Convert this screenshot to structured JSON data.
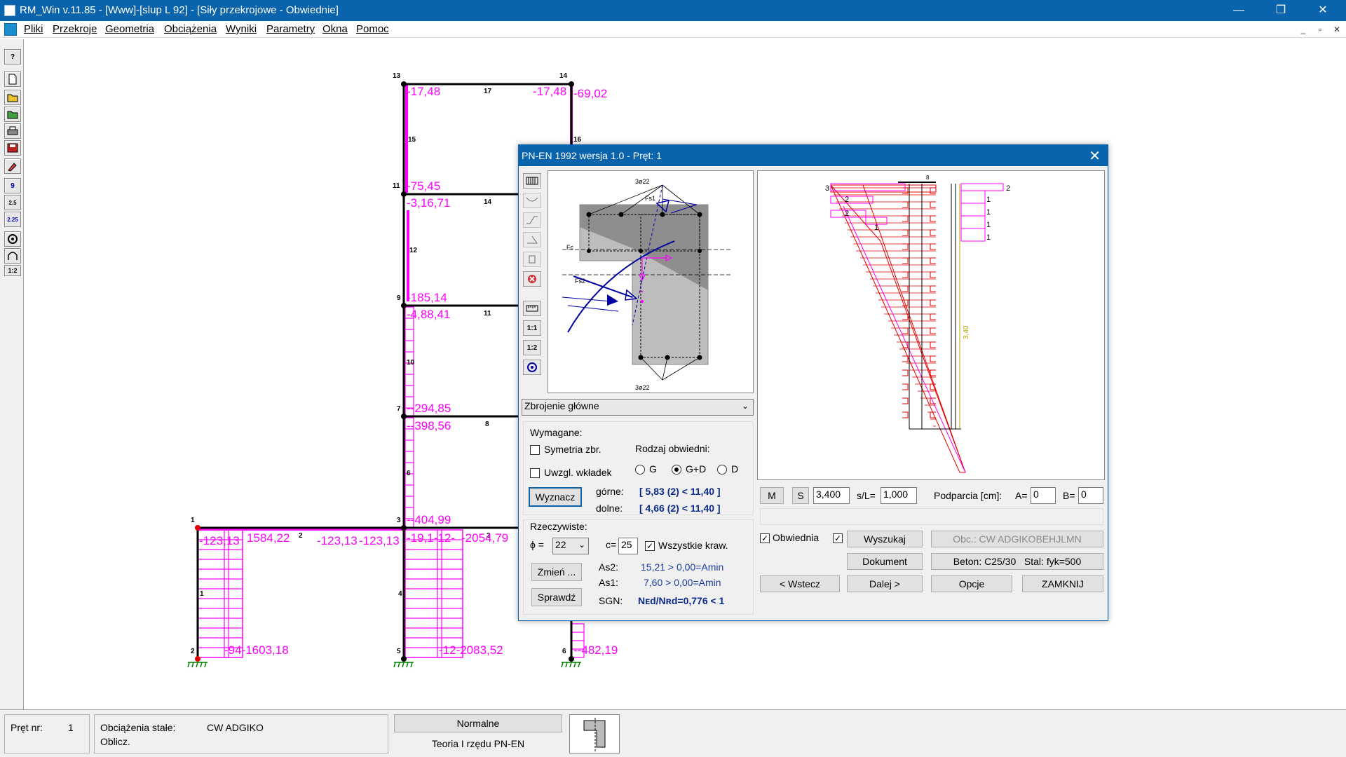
{
  "window": {
    "title": "RM_Win v.11.85 - [Www]-[slup L 92] - [Siły przekrojowe - Obwiednie]",
    "minimize": "—",
    "restore": "❐",
    "close": "✕"
  },
  "menu": {
    "items": [
      "Pliki",
      "Przekroje",
      "Geometria",
      "Obciążenia",
      "Wyniki",
      "Parametry",
      "Okna",
      "Pomoc"
    ],
    "mdi": [
      "_",
      "▫",
      "✕"
    ]
  },
  "toolbar": {
    "icons": [
      "help-icon",
      "new-file-icon",
      "open-icon",
      "open-folder-icon",
      "print-icon",
      "save-icon",
      "brush-icon",
      "node-numbers-icon",
      "dimension-icon",
      "scale-icon",
      "support-icon",
      "arc-icon",
      "ratio-icon"
    ],
    "texts": [
      "?",
      "",
      "",
      "",
      "",
      "",
      "",
      "9",
      "2.5",
      "2.25",
      "",
      "",
      "1:2"
    ]
  },
  "frame": {
    "node_labels": [
      "13",
      "14",
      "11",
      "9",
      "7",
      "3",
      "1",
      "2",
      "5",
      "6",
      "4"
    ],
    "bar_labels": [
      "17",
      "15",
      "16",
      "14",
      "12",
      "11",
      "10",
      "8",
      "6",
      "2",
      "3",
      "1"
    ],
    "values": {
      "v1": "-17,48",
      "v2": "-17,48",
      "v3": "-69,02",
      "v4": "-75,45",
      "v5": "-3,16,71",
      "v6": "-185,14",
      "v7": "-4,88,41",
      "v8": "--294,85",
      "v9": "--398,56",
      "v10": "--404,99",
      "v11": "-123,13",
      "v12": "1584,22",
      "v13": "-123,13",
      "v14": "-123,13",
      "v15": "-19,1-12-",
      "v16": "-2054,79",
      "v17": "-94-1603,18",
      "v18": "-12-2083,52",
      "v19": "--482,19"
    },
    "colors": {
      "diagram": "#ff00ff",
      "frame": "#000000",
      "support": "#008000",
      "node_red": "#e00000"
    }
  },
  "dialog": {
    "title": "PN-EN 1992 wersja 1.0 - Pręt: 1",
    "close": "✕",
    "left_tools": [
      "grid-icon",
      "moment-icon",
      "shear-icon",
      "angle-icon",
      "stirrup-icon",
      "delete-icon",
      "ruler-icon",
      "ratio-1-1-icon",
      "ratio-1-2-icon",
      "support-icon"
    ],
    "left_tool_texts": [
      "",
      "",
      "",
      "",
      "",
      "",
      "",
      "1:1",
      "1:2",
      ""
    ],
    "section": {
      "top_bars": "3ø22",
      "bottom_bars": "3ø22",
      "fs1": "Fs1",
      "fc": "Fc",
      "fs2": "Fs2"
    },
    "combo": "Zbrojenie główne",
    "wymagane": {
      "header": "Wymagane:",
      "symetria": "Symetria zbr.",
      "uwzgl": "Uwzgl. wkładek",
      "rodzaj": "Rodzaj obwiedni:",
      "radios": [
        "G",
        "G+D",
        "D"
      ],
      "wyznacz": "Wyznacz",
      "gorne_label": "górne:",
      "gorne_value": "[ 5,83 (2) < 11,40 ]",
      "dolne_label": "dolne:",
      "dolne_value": "[ 4,66 (2) < 11,40 ]"
    },
    "rzeczywiste": {
      "header": "Rzeczywiste:",
      "phi_label": "ϕ =",
      "phi_value": "22",
      "c_label": "c=",
      "c_value": "25",
      "wszystkie": "Wszystkie kraw.",
      "zmien": "Zmień ...",
      "sprawdz": "Sprawdź",
      "as2_label": "As2:",
      "as2_value": "15,21 > 0,00=Amin",
      "as1_label": "As1:",
      "as1_value": "7,60 > 0,00=Amin",
      "sgn_label": "SGN:",
      "sgn_value": "Nᴇd/Nʀd=0,776 < 1"
    },
    "diagram": {
      "marks_left": [
        "3",
        "2",
        "2",
        "1"
      ],
      "marks_right": [
        "2",
        "1",
        "1",
        "1",
        "1"
      ],
      "top_mark": "8",
      "length_label": "3,40"
    },
    "controls": {
      "m": "M",
      "s": "S",
      "x_value": "3,400",
      "sl_label": "s/L=",
      "sl_value": "1,000",
      "podparcia": "Podparcia [cm]:",
      "a_label": "A=",
      "a_value": "0",
      "b_label": "B=",
      "b_value": "0"
    },
    "buttons": {
      "obwiednia": "Obwiednia",
      "wyszukaj": "Wyszukaj",
      "obc": "Obc.: CW ADGIKOBEHJLMN",
      "dokument": "Dokument",
      "beton": "Beton: C25/30",
      "stal": "Stal: fyk=500",
      "wstecz": "< Wstecz",
      "dalej": "Dalej >",
      "opcje": "Opcje",
      "zamknij": "ZAMKNIJ"
    }
  },
  "status": {
    "pret_label": "Pręt nr:",
    "pret_value": "1",
    "obc_label": "Obciążenia stałe:",
    "obc_value": "CW ADGIKO",
    "oblicz": "Oblicz.",
    "normalne": "Normalne",
    "teoria": "Teoria I rzędu PN-EN"
  }
}
